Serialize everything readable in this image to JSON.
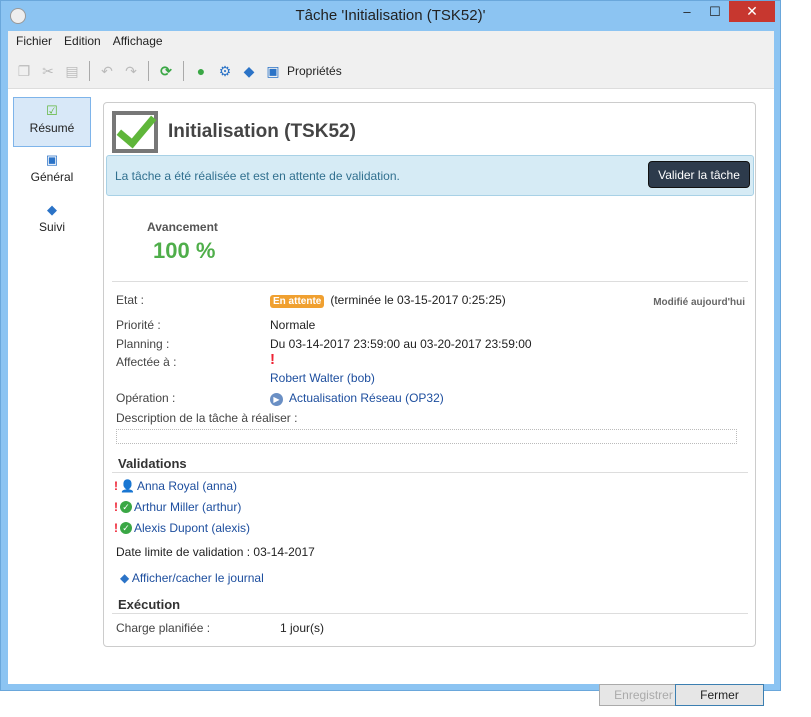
{
  "window": {
    "title": "Tâche 'Initialisation (TSK52)'",
    "minimize": "–",
    "maximize": "☐",
    "close": "✕"
  },
  "menu": [
    "Fichier",
    "Edition",
    "Affichage"
  ],
  "toolbar": {
    "properties_label": "Propriétés"
  },
  "sidebar": {
    "items": [
      {
        "label": "Résumé",
        "icon": "checkbox-icon"
      },
      {
        "label": "Général",
        "icon": "clipboard-icon"
      },
      {
        "label": "Suivi",
        "icon": "tracking-icon"
      }
    ]
  },
  "header": {
    "title": "Initialisation (TSK52)"
  },
  "info": {
    "message": "La tâche a été réalisée et est en attente de validation.",
    "button": "Valider la tâche"
  },
  "progress": {
    "label": "Avancement",
    "value": "100 %"
  },
  "details": {
    "etat_label": "Etat :",
    "etat_badge": "En attente",
    "etat_value": "(terminée le 03-15-2017 0:25:25)",
    "modified": "Modifié aujourd'hui",
    "priorite_label": "Priorité :",
    "priorite_value": "Normale",
    "planning_label": "Planning :",
    "planning_value": "Du 03-14-2017 23:59:00 au 03-20-2017 23:59:00",
    "affectee_label": "Affectée à :",
    "affectee_value": "Robert Walter (bob)",
    "operation_label": "Opération :",
    "operation_value": "Actualisation Réseau (OP32)",
    "description_label": "Description de la tâche à réaliser :"
  },
  "validations": {
    "title": "Validations",
    "items": [
      "Anna Royal (anna)",
      "Arthur Miller (arthur)",
      "Alexis Dupont (alexis)"
    ],
    "deadline": "Date limite de validation : 03-14-2017",
    "journal": "Afficher/cacher le journal"
  },
  "execution": {
    "title": "Exécution",
    "charge_label": "Charge planifiée :",
    "charge_value": "1 jour(s)"
  },
  "footer": {
    "save": "Enregistrer",
    "close": "Fermer"
  }
}
